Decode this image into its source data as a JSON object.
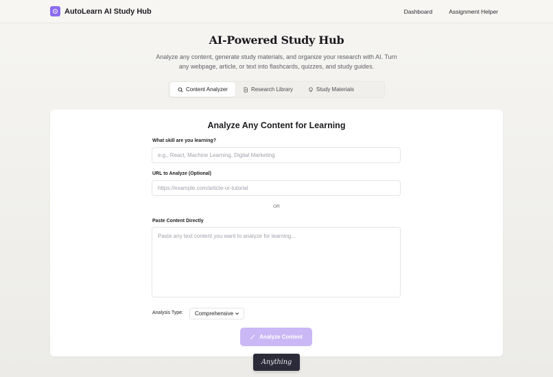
{
  "header": {
    "brand_name": "AutoLearn AI Study Hub",
    "nav": [
      "Dashboard",
      "Assignment Helper"
    ]
  },
  "hero": {
    "title": "AI-Powered Study Hub",
    "subtitle": "Analyze any content, generate study materials, and organize your research with AI. Turn any webpage, article, or text into flashcards, quizzes, and study guides."
  },
  "tabs": [
    {
      "label": "Content Analyzer",
      "icon": "search-icon",
      "active": true
    },
    {
      "label": "Research Library",
      "icon": "document-icon",
      "active": false
    },
    {
      "label": "Study Materials",
      "icon": "lightbulb-icon",
      "active": false
    }
  ],
  "form": {
    "title": "Analyze Any Content for Learning",
    "skill_label": "What skill are you learning?",
    "skill_placeholder": "e.g., React, Machine Learning, Digital Marketing",
    "skill_value": "",
    "url_label": "URL to Analyze (Optional)",
    "url_placeholder": "https://example.com/article-or-tutorial",
    "url_value": "",
    "or_text": "OR",
    "content_label": "Paste Content Directly",
    "content_placeholder": "Paste any text content you want to analyze for learning...",
    "content_value": "",
    "analysis_type_label": "Analysis Type:",
    "analysis_type_value": "Comprehensive",
    "analyze_button": "Analyze Content"
  },
  "badge": {
    "label": "Anything"
  },
  "colors": {
    "accent": "#8b6cf0",
    "button_disabled": "#c9b8f5",
    "badge_bg": "#2b2b3a"
  }
}
